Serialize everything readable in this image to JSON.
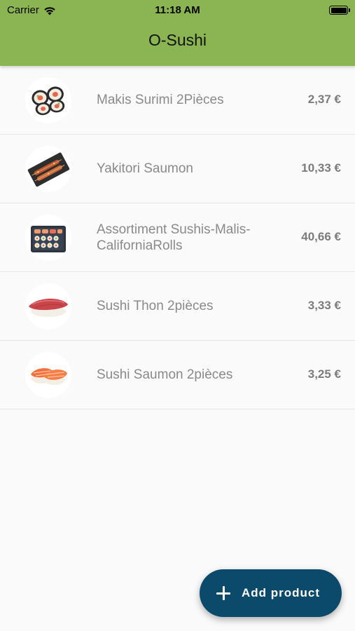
{
  "status_bar": {
    "carrier": "Carrier",
    "time": "11:18 AM"
  },
  "app_bar": {
    "title": "O-Sushi",
    "color": "#8bb552"
  },
  "products": [
    {
      "name": "Makis Surimi 2Pièces",
      "price": "2,37 €",
      "image": "maki-rolls-image"
    },
    {
      "name": "Yakitori Saumon",
      "price": "10,33 €",
      "image": "yakitori-skewers-image"
    },
    {
      "name": "Assortiment Sushis-Malis-CaliforniaRolls",
      "price": "40,66 €",
      "image": "sushi-assortment-tray-image"
    },
    {
      "name": "Sushi Thon 2pièces",
      "price": "3,33 €",
      "image": "tuna-nigiri-image"
    },
    {
      "name": "Sushi Saumon 2pièces",
      "price": "3,25 €",
      "image": "salmon-nigiri-image"
    }
  ],
  "fab": {
    "label": "Add product",
    "icon": "plus-icon",
    "color": "#0c4a6b"
  }
}
